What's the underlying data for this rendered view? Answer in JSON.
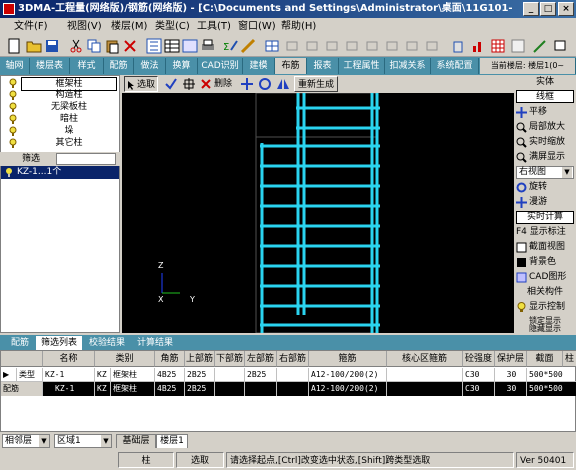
{
  "window": {
    "title": "3DMA-工程量(网络版)/钢筋(网络版) - [C:\\Documents and Settings\\Administrator\\桌面\\11G101-",
    "min": "_",
    "max": "□",
    "close": "×"
  },
  "menu": [
    "文件(F)",
    "视图(V)",
    "楼层(M)",
    "类型(C)",
    "工具(T)",
    "窗口(W)",
    "帮助(H)"
  ],
  "tabs": [
    "轴网",
    "楼层表",
    "样式",
    "配筋",
    "做法",
    "换算",
    "CAD识别",
    "建模",
    "布筋",
    "报表",
    "工程属性",
    "扣减关系",
    "系统配置"
  ],
  "current_floor": "当前楼层: 楼层1(0~",
  "left_panel": {
    "items": [
      "框架柱",
      "构造柱",
      "无梁板柱",
      "暗柱",
      "垛",
      "其它柱"
    ],
    "filter_label": "筛选",
    "filter_item": "KZ-1...1个"
  },
  "draw_toolbar": {
    "select": "选取",
    "delete": "删除",
    "regen": "重新生成"
  },
  "canvas": {
    "axis_z": "Z",
    "axis_x": "X",
    "axis_y": "Y"
  },
  "right_panel": {
    "header": "实体",
    "mode": "线框",
    "items": [
      "平移",
      "局部放大",
      "实时缩放",
      "满屏显示"
    ],
    "view_select": "右视图",
    "items2": [
      "旋转",
      "漫游"
    ],
    "realtime": "实时计算",
    "items3": [
      "F4 显示标注",
      "截面视图",
      "背景色",
      "CAD图形"
    ],
    "related": "相关构件",
    "display_ctrl": "显示控制",
    "lock": "锁定显示",
    "more": "隐藏显示"
  },
  "bottom_tabs": [
    "配筋",
    "筛选列表",
    "校验结果",
    "计算结果"
  ],
  "table": {
    "headers": [
      "名称",
      "类别",
      "角筋",
      "上部筋",
      "下部筋",
      "左部筋",
      "右部筋",
      "箍筋",
      "核心区箍筋",
      "砼强度",
      "保护层",
      "截面",
      "柱"
    ],
    "rows": [
      {
        "label": "类型",
        "name": "KZ-1",
        "type": "KZ",
        "cat": "框架柱",
        "corner": "4B25",
        "top": "2B25",
        "bottom": "",
        "left": "2B25",
        "right": "",
        "stirrup": "A12-100/200(2)",
        "core": "",
        "concrete": "C30",
        "cover": "30",
        "section": "500*500"
      },
      {
        "label": "配筋",
        "name": "KZ-1",
        "type": "KZ",
        "cat": "框架柱",
        "corner": "4B25",
        "top": "2B25",
        "bottom": "",
        "left": "",
        "right": "",
        "stirrup": "A12-100/200(2)",
        "core": "",
        "concrete": "C30",
        "cover": "30",
        "section": "500*500"
      }
    ]
  },
  "floor_tabs": [
    "基础层",
    "楼层1"
  ],
  "status": {
    "floor_combo": "相邻层",
    "region_combo": "区域1",
    "component": "柱",
    "mode": "选取",
    "hint": "请选择起点,[Ctrl]改变选中状态,[Shift]跨类型选取",
    "version": "Ver 50401"
  },
  "colors": {
    "accent": "#4a90a8",
    "rebar": "#2ad4f0",
    "canvas": "#000000"
  }
}
